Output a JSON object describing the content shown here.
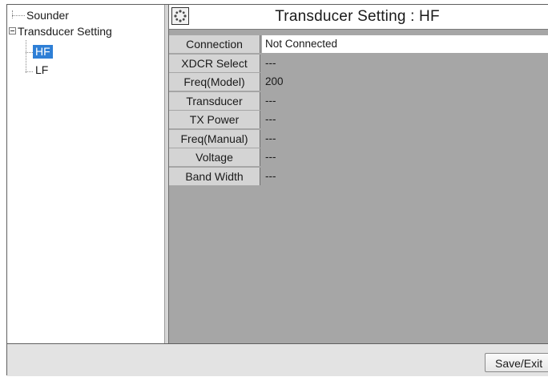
{
  "tree": {
    "items": [
      {
        "label": "Sounder"
      },
      {
        "label": "Transducer Setting"
      },
      {
        "label": "HF",
        "selected": true
      },
      {
        "label": "LF"
      }
    ]
  },
  "panel": {
    "title_icon": "sun-burst-icon",
    "title": "Transducer Setting : HF",
    "rows": [
      {
        "label": "Connection",
        "value": "Not Connected"
      },
      {
        "label": "XDCR Select",
        "value": "---"
      },
      {
        "label": "Freq(Model)",
        "value": "200"
      },
      {
        "label": "Transducer",
        "value": "---"
      },
      {
        "label": "TX Power",
        "value": "---"
      },
      {
        "label": "Freq(Manual)",
        "value": "---"
      },
      {
        "label": "Voltage",
        "value": "---"
      },
      {
        "label": "Band Width",
        "value": "---"
      }
    ]
  },
  "footer": {
    "save_label": "Save/Exit"
  },
  "colors": {
    "selection": "#2e7fd6",
    "panel_background": "#a6a6a6",
    "label_cell": "#d4d4d4",
    "footer": "#e3e3e3"
  }
}
